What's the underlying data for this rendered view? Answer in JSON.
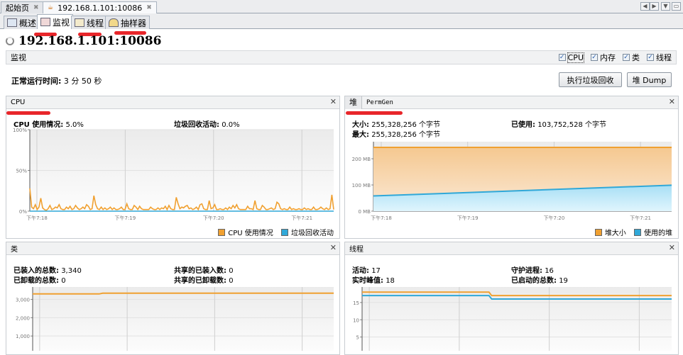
{
  "doc_tabs": [
    {
      "label": "起始页"
    },
    {
      "label": "192.168.1.101:10086"
    }
  ],
  "sub_tabs": [
    {
      "label": "概述"
    },
    {
      "label": "监视"
    },
    {
      "label": "线程"
    },
    {
      "label": "抽样器"
    }
  ],
  "title": "192.168.1.101:10086",
  "monitor": {
    "label": "监视",
    "checkboxes": [
      {
        "label": "CPU",
        "checked": true
      },
      {
        "label": "内存",
        "checked": true
      },
      {
        "label": "类",
        "checked": true
      },
      {
        "label": "线程",
        "checked": true
      }
    ],
    "uptime_label": "正常运行时间:",
    "uptime_value": "3 分 50 秒",
    "gc_button": "执行垃圾回收",
    "heap_dump_button": "堆 Dump"
  },
  "colors": {
    "orange": "#f0a030",
    "blue": "#30a8d8"
  },
  "time_ticks": [
    "下午7:18",
    "下午7:19",
    "下午7:20",
    "下午7:21"
  ],
  "cpu": {
    "title": "CPU",
    "usage_label": "CPU 使用情况:",
    "usage_value": "5.0%",
    "gc_label": "垃圾回收活动:",
    "gc_value": "0.0%",
    "legend": [
      "CPU 使用情况",
      "垃圾回收活动"
    ]
  },
  "heap": {
    "tab_heap": "堆",
    "tab_permgen": "PermGen",
    "size_label": "大小:",
    "size_value": "255,328,256 个字节",
    "max_label": "最大:",
    "max_value": "255,328,256 个字节",
    "used_label": "已使用:",
    "used_value": "103,752,528 个字节",
    "legend": [
      "堆大小",
      "使用的堆"
    ]
  },
  "classes": {
    "title": "类",
    "loaded_label": "已装入的总数:",
    "loaded_value": "3,340",
    "unloaded_label": "已卸载的总数:",
    "unloaded_value": "0",
    "shared_loaded_label": "共享的已装入数:",
    "shared_loaded_value": "0",
    "shared_unloaded_label": "共享的已卸载数:",
    "shared_unloaded_value": "0"
  },
  "threads": {
    "title": "线程",
    "live_label": "活动:",
    "live_value": "17",
    "peak_label": "实时峰值:",
    "peak_value": "18",
    "daemon_label": "守护进程:",
    "daemon_value": "16",
    "started_label": "已启动的总数:",
    "started_value": "19"
  },
  "chart_data": [
    {
      "type": "line",
      "title": "CPU",
      "xlim_minutes_after_7_18": [
        -0.08,
        3.36
      ],
      "ylim": [
        0,
        100
      ],
      "yticks": [
        "0%",
        "50%",
        "100%"
      ],
      "yvals": [
        0,
        50,
        100
      ],
      "series": [
        {
          "name": "CPU 使用情况",
          "values": [
            28,
            5,
            3,
            8,
            2,
            5,
            16,
            4,
            2,
            1,
            3,
            7,
            2,
            3,
            5,
            4,
            8,
            3,
            2,
            2,
            5,
            3,
            6,
            2,
            3,
            7,
            4,
            2,
            3,
            5,
            3,
            8,
            6,
            2,
            3,
            19,
            8,
            3,
            2,
            5,
            2,
            4,
            2,
            3,
            5,
            2,
            4,
            2,
            2,
            3,
            5,
            2,
            2,
            9,
            3,
            2,
            2,
            7,
            5,
            2,
            6,
            3,
            2,
            2,
            2,
            2,
            5,
            3,
            2,
            2,
            4,
            2,
            4,
            3,
            6,
            2,
            7,
            3,
            2,
            2,
            17,
            9,
            3,
            5,
            4,
            6,
            7,
            3,
            4,
            2,
            3,
            5,
            2,
            8,
            9,
            3,
            2,
            2,
            13,
            3,
            4,
            8,
            2,
            2,
            3,
            2,
            2,
            4,
            2,
            5,
            3,
            7,
            4,
            8,
            3,
            2,
            2,
            2,
            2,
            6,
            3,
            3,
            2,
            13,
            3,
            2,
            2,
            7,
            5,
            2,
            2,
            3,
            4,
            2,
            3,
            11,
            9,
            3,
            2,
            3,
            2,
            2,
            5,
            2,
            3,
            2,
            2,
            3,
            2,
            2,
            4,
            2,
            3,
            2,
            2,
            5,
            2,
            2,
            3,
            5,
            3,
            2,
            4,
            2,
            3,
            20,
            2
          ]
        },
        {
          "name": "垃圾回收活动",
          "values": [
            0,
            0
          ]
        }
      ]
    },
    {
      "type": "area",
      "title": "堆",
      "xlim_minutes_after_7_18": [
        -0.09,
        3.36
      ],
      "ylim": [
        0,
        265
      ],
      "yticks": [
        "0 MB",
        "100 MB",
        "200 MB"
      ],
      "yvals": [
        0,
        100,
        200
      ],
      "series": [
        {
          "name": "堆大小",
          "values": [
            243.5,
            243.5
          ]
        },
        {
          "name": "使用的堆",
          "values": [
            58,
            99
          ]
        }
      ]
    },
    {
      "type": "line",
      "title": "类",
      "xlim_minutes_after_7_18": [
        -0.08,
        3.36
      ],
      "ylim": [
        0,
        3680
      ],
      "yticks": [
        "1,000",
        "2,000",
        "3,000"
      ],
      "yvals": [
        1000,
        2000,
        3000
      ],
      "series": [
        {
          "name": "已装入的总数",
          "x": [
            -0.08,
            0.68,
            0.72,
            3.36
          ],
          "values": [
            3300,
            3300,
            3340,
            3340
          ]
        }
      ]
    },
    {
      "type": "line",
      "title": "线程",
      "xlim_minutes_after_7_18": [
        -0.08,
        3.36
      ],
      "ylim": [
        0,
        19.5
      ],
      "yticks": [
        "5",
        "10",
        "15"
      ],
      "yvals": [
        5,
        10,
        15
      ],
      "series": [
        {
          "name": "实时峰值",
          "x": [
            -0.08,
            1.33,
            1.36,
            3.36
          ],
          "values": [
            18,
            18,
            17,
            17
          ]
        },
        {
          "name": "活动",
          "x": [
            -0.08,
            1.33,
            1.36,
            3.36
          ],
          "values": [
            17,
            17,
            16,
            16
          ]
        }
      ]
    }
  ]
}
